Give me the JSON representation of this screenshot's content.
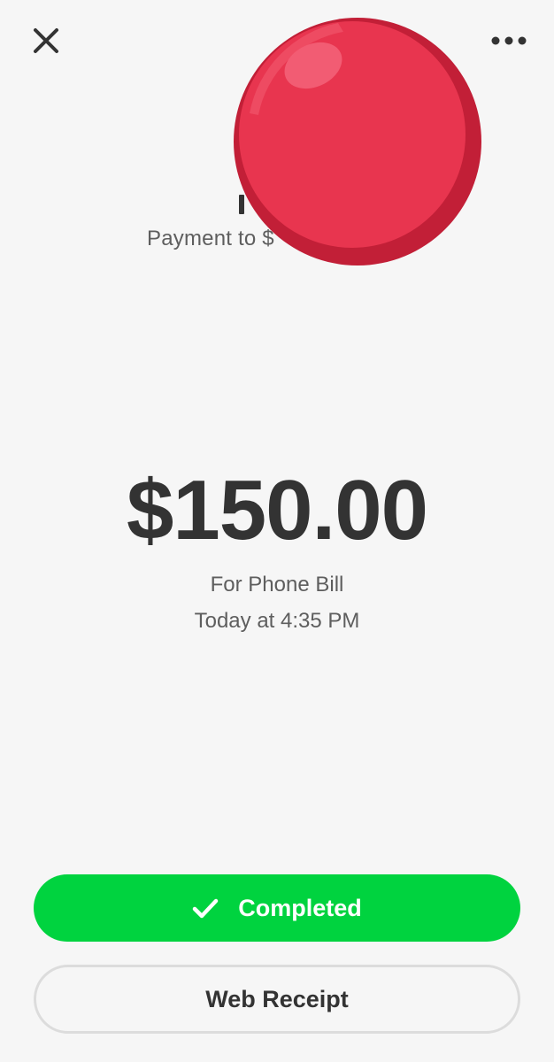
{
  "header": {
    "close_icon": "close-icon",
    "more_icon": "more-horizontal-icon"
  },
  "payee": {
    "label": "Payment to $"
  },
  "redaction": {
    "color": "#e8354f"
  },
  "transaction": {
    "amount": "$150.00",
    "memo": "For Phone Bill",
    "timestamp": "Today at 4:35 PM"
  },
  "actions": {
    "completed_label": "Completed",
    "completed_icon": "checkmark-icon",
    "completed_color": "#00d33f",
    "web_receipt_label": "Web Receipt"
  }
}
